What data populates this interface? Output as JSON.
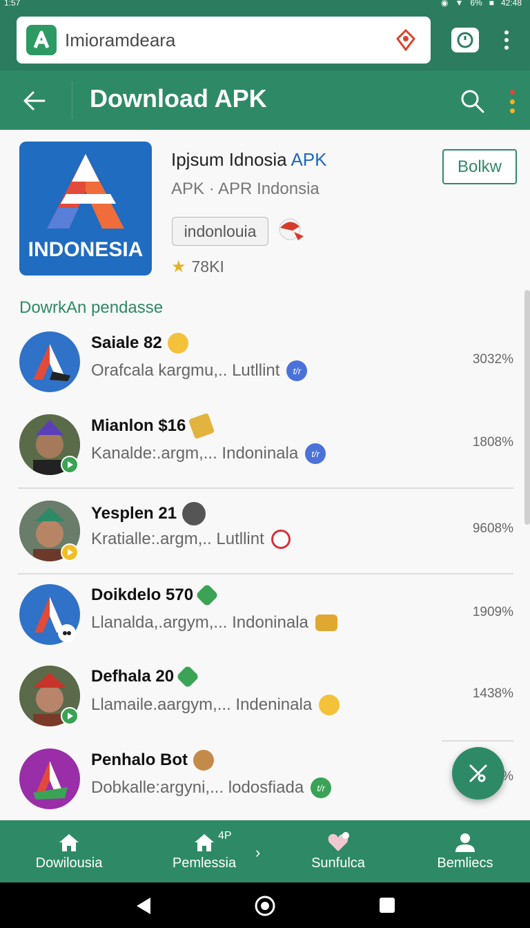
{
  "status_bar": {
    "time": "1:57",
    "battery": "6%",
    "clock": "42:48"
  },
  "browser": {
    "url": "Imioramdeara"
  },
  "appbar": {
    "title": "Download APK"
  },
  "app": {
    "title": "Ipjsum Idnosia",
    "title_accent": "APK",
    "subtitle": "APK  ·  APR Indonsia",
    "tag": "indonlouia",
    "rating": "78KI",
    "icon_text": "INDONESIA",
    "follow_label": "Bolkw"
  },
  "section_title": "DowrkAn pendasse",
  "list": [
    {
      "title": "Saiale 82",
      "sub": "Orafcala kargmu,.. Lutllint",
      "pill": "t/r",
      "value": "3032%"
    },
    {
      "title": "Mianlon $16",
      "sub": "Kanalde:.argm,... Indoninala",
      "pill": "t/r",
      "value": "1808%"
    },
    {
      "title": "Yesplen 21",
      "sub": "Kratialle:.argm,.. Lutllint",
      "pill": "",
      "value": "9608%"
    },
    {
      "title": "Doikdelo 570",
      "sub": "Llanalda,.argym,... Indoninala",
      "pill": "",
      "value": "1909%"
    },
    {
      "title": "Defhala 20",
      "sub": "Llamaile.aargym,... Indeninala",
      "pill": "",
      "value": "1438%"
    },
    {
      "title": "Penhalo Bot",
      "sub": "Dobkalle:argyni,... lodosfiada",
      "pill": "t/r",
      "value": "%"
    }
  ],
  "bottom_nav": [
    {
      "label": "Dowilousia"
    },
    {
      "label": "Pemlessia",
      "sup": "4P"
    },
    {
      "label": "Sunfulca"
    },
    {
      "label": "Bemliecs"
    }
  ],
  "colors": {
    "primary": "#2e8a66",
    "status": "#2c7d5f",
    "accent_blue": "#2266c4"
  }
}
